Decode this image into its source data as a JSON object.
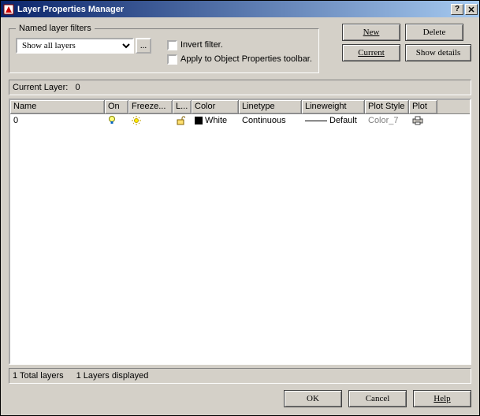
{
  "window": {
    "title": "Layer Properties Manager"
  },
  "filters": {
    "legend": "Named layer filters",
    "combo_value": "Show all layers",
    "browse_label": "...",
    "invert_label": "Invert filter.",
    "apply_label": "Apply to Object Properties toolbar."
  },
  "buttons": {
    "new": "New",
    "delete": "Delete",
    "current": "Current",
    "show_details": "Show details",
    "ok": "OK",
    "cancel": "Cancel",
    "help": "Help"
  },
  "current_layer_label": "Current Layer:",
  "current_layer_value": "0",
  "columns": {
    "name": "Name",
    "on": "On",
    "freeze": "Freeze...",
    "lock": "L...",
    "color": "Color",
    "linetype": "Linetype",
    "lineweight": "Lineweight",
    "plotstyle": "Plot Style",
    "plot": "Plot"
  },
  "rows": [
    {
      "name": "0",
      "on_icon": "bulb-on-icon",
      "freeze_icon": "sun-icon",
      "lock_icon": "unlock-icon",
      "color_name": "White",
      "color_hex": "#000000",
      "linetype": "Continuous",
      "lineweight": "Default",
      "plotstyle": "Color_7",
      "plot_icon": "printer-icon"
    }
  ],
  "status": {
    "total": "1 Total layers",
    "displayed": "1 Layers displayed"
  }
}
